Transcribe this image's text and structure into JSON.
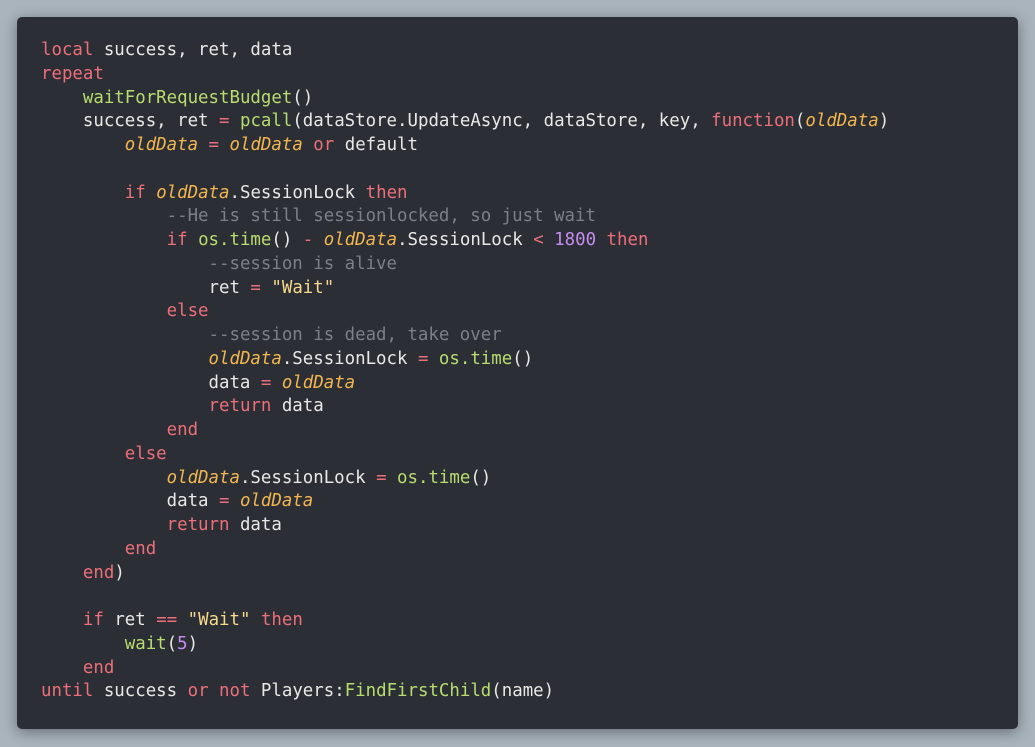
{
  "editor": {
    "colors": {
      "page_background": "#a9b4bd",
      "editor_background": "#2c2e35",
      "plain": "#e8e8e6",
      "keyword": "#ec6f7a",
      "function": "#b7dd6f",
      "parameter": "#f2b64f",
      "string": "#f6d98a",
      "number": "#c48cf0",
      "comment": "#7b7f88"
    },
    "lines": [
      [
        [
          "kw",
          "local"
        ],
        [
          "plain",
          " success, ret, data"
        ]
      ],
      [
        [
          "kw",
          "repeat"
        ]
      ],
      [
        [
          "plain",
          "    "
        ],
        [
          "fn",
          "waitForRequestBudget"
        ],
        [
          "plain",
          "()"
        ]
      ],
      [
        [
          "plain",
          "    success, ret "
        ],
        [
          "op",
          "="
        ],
        [
          "plain",
          " "
        ],
        [
          "fn",
          "pcall"
        ],
        [
          "plain",
          "(dataStore.UpdateAsync, dataStore, key, "
        ],
        [
          "kw",
          "function"
        ],
        [
          "plain",
          "("
        ],
        [
          "param",
          "oldData"
        ],
        [
          "plain",
          ")"
        ]
      ],
      [
        [
          "plain",
          "        "
        ],
        [
          "param",
          "oldData"
        ],
        [
          "plain",
          " "
        ],
        [
          "op",
          "="
        ],
        [
          "plain",
          " "
        ],
        [
          "param",
          "oldData"
        ],
        [
          "plain",
          " "
        ],
        [
          "kw",
          "or"
        ],
        [
          "plain",
          " default"
        ]
      ],
      [],
      [
        [
          "plain",
          "        "
        ],
        [
          "kw",
          "if"
        ],
        [
          "plain",
          " "
        ],
        [
          "param",
          "oldData"
        ],
        [
          "plain",
          ".SessionLock "
        ],
        [
          "kw",
          "then"
        ]
      ],
      [
        [
          "plain",
          "            "
        ],
        [
          "cmt",
          "--He is still sessionlocked, so just wait"
        ]
      ],
      [
        [
          "plain",
          "            "
        ],
        [
          "kw",
          "if"
        ],
        [
          "plain",
          " "
        ],
        [
          "fn",
          "os.time"
        ],
        [
          "plain",
          "() "
        ],
        [
          "op",
          "-"
        ],
        [
          "plain",
          " "
        ],
        [
          "param",
          "oldData"
        ],
        [
          "plain",
          ".SessionLock "
        ],
        [
          "op",
          "<"
        ],
        [
          "plain",
          " "
        ],
        [
          "num",
          "1800"
        ],
        [
          "plain",
          " "
        ],
        [
          "kw",
          "then"
        ]
      ],
      [
        [
          "plain",
          "                "
        ],
        [
          "cmt",
          "--session is alive"
        ]
      ],
      [
        [
          "plain",
          "                ret "
        ],
        [
          "op",
          "="
        ],
        [
          "plain",
          " "
        ],
        [
          "str",
          "\"Wait\""
        ]
      ],
      [
        [
          "plain",
          "            "
        ],
        [
          "kw",
          "else"
        ]
      ],
      [
        [
          "plain",
          "                "
        ],
        [
          "cmt",
          "--session is dead, take over"
        ]
      ],
      [
        [
          "plain",
          "                "
        ],
        [
          "param",
          "oldData"
        ],
        [
          "plain",
          ".SessionLock "
        ],
        [
          "op",
          "="
        ],
        [
          "plain",
          " "
        ],
        [
          "fn",
          "os.time"
        ],
        [
          "plain",
          "()"
        ]
      ],
      [
        [
          "plain",
          "                data "
        ],
        [
          "op",
          "="
        ],
        [
          "plain",
          " "
        ],
        [
          "param",
          "oldData"
        ]
      ],
      [
        [
          "plain",
          "                "
        ],
        [
          "kw",
          "return"
        ],
        [
          "plain",
          " data"
        ]
      ],
      [
        [
          "plain",
          "            "
        ],
        [
          "kw",
          "end"
        ]
      ],
      [
        [
          "plain",
          "        "
        ],
        [
          "kw",
          "else"
        ]
      ],
      [
        [
          "plain",
          "            "
        ],
        [
          "param",
          "oldData"
        ],
        [
          "plain",
          ".SessionLock "
        ],
        [
          "op",
          "="
        ],
        [
          "plain",
          " "
        ],
        [
          "fn",
          "os.time"
        ],
        [
          "plain",
          "()"
        ]
      ],
      [
        [
          "plain",
          "            data "
        ],
        [
          "op",
          "="
        ],
        [
          "plain",
          " "
        ],
        [
          "param",
          "oldData"
        ]
      ],
      [
        [
          "plain",
          "            "
        ],
        [
          "kw",
          "return"
        ],
        [
          "plain",
          " data"
        ]
      ],
      [
        [
          "plain",
          "        "
        ],
        [
          "kw",
          "end"
        ]
      ],
      [
        [
          "plain",
          "    "
        ],
        [
          "kw",
          "end"
        ],
        [
          "plain",
          ")"
        ]
      ],
      [],
      [
        [
          "plain",
          "    "
        ],
        [
          "kw",
          "if"
        ],
        [
          "plain",
          " ret "
        ],
        [
          "op",
          "=="
        ],
        [
          "plain",
          " "
        ],
        [
          "str",
          "\"Wait\""
        ],
        [
          "plain",
          " "
        ],
        [
          "kw",
          "then"
        ]
      ],
      [
        [
          "plain",
          "        "
        ],
        [
          "fn",
          "wait"
        ],
        [
          "plain",
          "("
        ],
        [
          "num",
          "5"
        ],
        [
          "plain",
          ")"
        ]
      ],
      [
        [
          "plain",
          "    "
        ],
        [
          "kw",
          "end"
        ]
      ],
      [
        [
          "kw",
          "until"
        ],
        [
          "plain",
          " success "
        ],
        [
          "kw",
          "or"
        ],
        [
          "plain",
          " "
        ],
        [
          "kw",
          "not"
        ],
        [
          "plain",
          " Players:"
        ],
        [
          "fn",
          "FindFirstChild"
        ],
        [
          "plain",
          "(name)"
        ]
      ]
    ]
  }
}
